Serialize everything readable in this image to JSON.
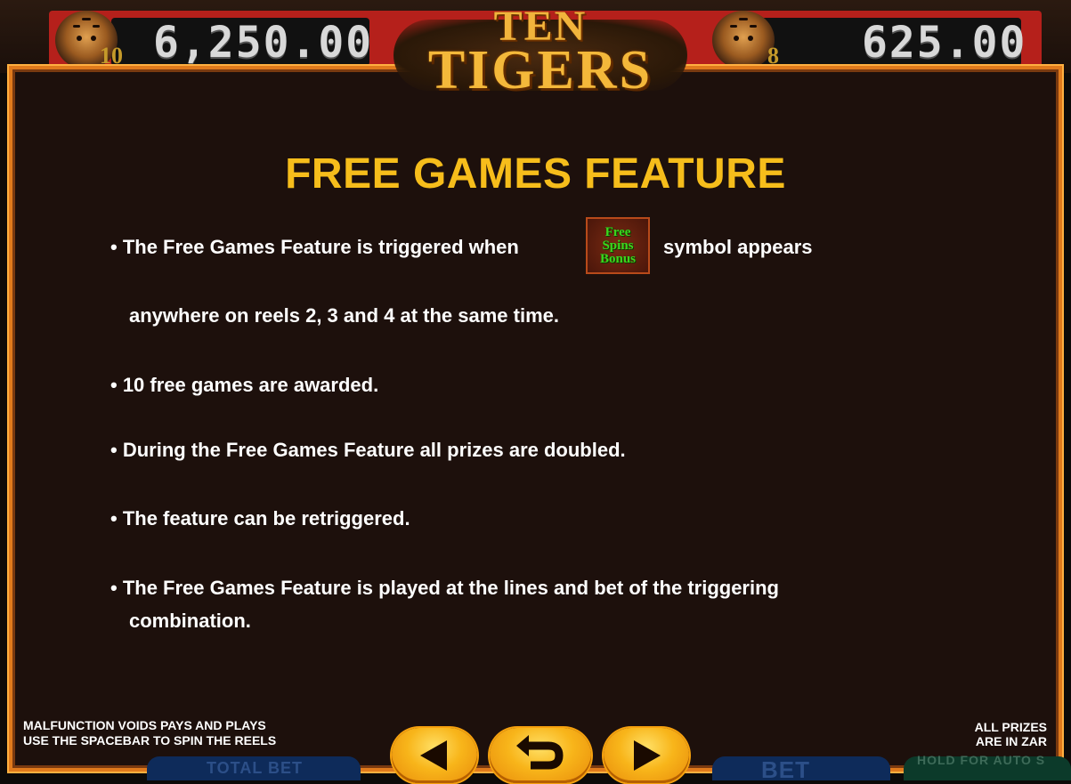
{
  "jackpots": {
    "left": {
      "tier": "10",
      "value": "6,250.00"
    },
    "right": {
      "tier": "8",
      "value": "625.00"
    }
  },
  "logo": {
    "line1": "TEN",
    "line2": "TIGERS"
  },
  "panel": {
    "title": "FREE GAMES FEATURE",
    "rule1_before": "• The Free Games Feature is triggered when",
    "rule1_after": "symbol appears",
    "rule1_cont": "anywhere on reels 2, 3 and 4 at the same time.",
    "rule2": "• 10 free games are awarded.",
    "rule3": "• During the Free Games Feature all prizes are doubled.",
    "rule4": "• The feature can be retriggered.",
    "rule5_line1": "• The Free Games Feature is played at the lines and bet of the triggering",
    "rule5_line2": "combination.",
    "symbol": {
      "line1": "Free",
      "line2": "Spins",
      "line3": "Bonus"
    }
  },
  "footer": {
    "left_line1": "MALFUNCTION VOIDS PAYS AND PLAYS",
    "left_line2": "USE THE SPACEBAR TO SPIN THE REELS",
    "right_line1": "ALL PRIZES",
    "right_line2": "ARE IN ZAR"
  },
  "under": {
    "total_bet": "TOTAL BET",
    "bet": "BET",
    "hold_auto": "HOLD FOR AUTO S"
  },
  "nav": {
    "prev_icon": "triangle-left-icon",
    "back_icon": "return-arrow-icon",
    "next_icon": "triangle-right-icon"
  },
  "colors": {
    "title": "#f6bd1b",
    "panel_border": "#e07a1c",
    "panel_bg": "#1d100c",
    "button": "#f8b51a",
    "symbol_text": "#3cd61e"
  }
}
